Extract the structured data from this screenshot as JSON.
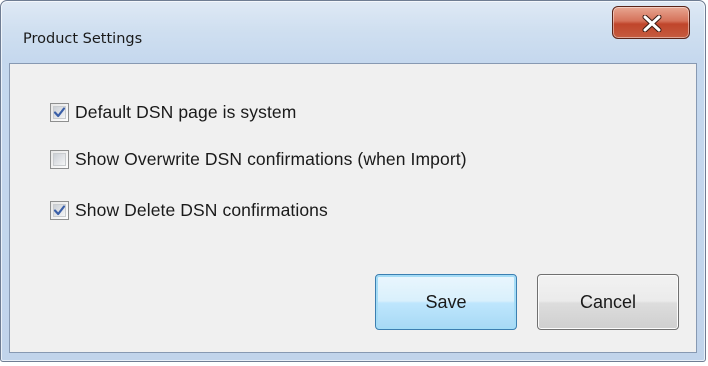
{
  "window": {
    "title": "Product Settings",
    "close_icon": "close-x-icon"
  },
  "options": [
    {
      "label": "Default DSN page is system",
      "checked": true
    },
    {
      "label": "Show Overwrite DSN confirmations (when Import)",
      "checked": false
    },
    {
      "label": "Show Delete DSN confirmations",
      "checked": true
    }
  ],
  "buttons": {
    "save_label": "Save",
    "cancel_label": "Cancel"
  },
  "colors": {
    "titlebar": "#c5d8ee",
    "close_button": "#c0452b",
    "checkmark": "#3a5fa8",
    "default_button_border": "#3c7fb1"
  }
}
